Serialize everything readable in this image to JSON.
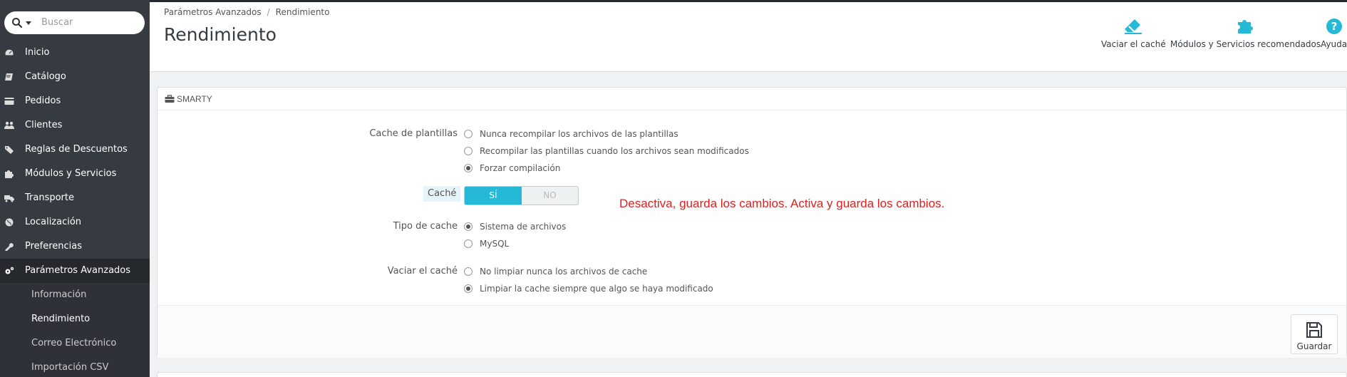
{
  "search": {
    "placeholder": "Buscar"
  },
  "sidebar": {
    "items": [
      {
        "label": "Inicio",
        "icon": "dashboard-icon"
      },
      {
        "label": "Catálogo",
        "icon": "book-icon"
      },
      {
        "label": "Pedidos",
        "icon": "credit-card-icon"
      },
      {
        "label": "Clientes",
        "icon": "users-icon"
      },
      {
        "label": "Reglas de Descuentos",
        "icon": "tags-icon"
      },
      {
        "label": "Módulos y Servicios",
        "icon": "puzzle-icon"
      },
      {
        "label": "Transporte",
        "icon": "truck-icon"
      },
      {
        "label": "Localización",
        "icon": "globe-icon"
      },
      {
        "label": "Preferencias",
        "icon": "wrench-icon"
      },
      {
        "label": "Parámetros Avanzados",
        "icon": "cogs-icon"
      }
    ],
    "subitems": [
      {
        "label": "Información"
      },
      {
        "label": "Rendimiento"
      },
      {
        "label": "Correo Electrónico"
      },
      {
        "label": "Importación CSV"
      }
    ]
  },
  "header": {
    "breadcrumb": [
      "Parámetros Avanzados",
      "Rendimiento"
    ],
    "breadcrumb_sep": "/",
    "title": "Rendimiento",
    "toolbar": {
      "clear_cache": "Vaciar el caché",
      "modules": "Módulos y Servicios recomendados",
      "help": "Ayuda"
    }
  },
  "panel": {
    "heading": "SMARTY",
    "template_cache": {
      "label": "Cache de plantillas",
      "options": [
        "Nunca recompilar los archivos de las plantillas",
        "Recompilar las plantillas cuando los archivos sean modificados",
        "Forzar compilación"
      ],
      "selected": 2
    },
    "cache": {
      "label": "Caché",
      "on": "SÍ",
      "off": "NO",
      "value": "SÍ"
    },
    "cache_type": {
      "label": "Tipo de cache",
      "options": [
        "Sistema de archivos",
        "MySQL"
      ],
      "selected": 0
    },
    "clear_cache": {
      "label": "Vaciar el caché",
      "options": [
        "No limpiar nunca los archivos de cache",
        "Limpiar la cache siempre que algo se haya modificado"
      ],
      "selected": 1
    },
    "annotation": "Desactiva, guarda los cambios. Activa y guarda los cambios.",
    "save": "Guardar"
  },
  "colors": {
    "sidebar_bg": "#363a41",
    "accent": "#25b9d7",
    "annotation": "#e02020"
  }
}
